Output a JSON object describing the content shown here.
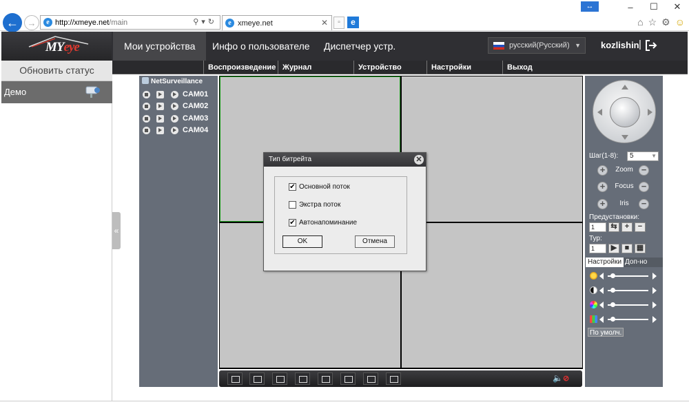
{
  "browser": {
    "url_host": "http://xmeye.net",
    "url_path": "/main",
    "tab_title": "xmeye.net"
  },
  "header": {
    "logo": "MYeye",
    "nav": {
      "devices": "Мои устройства",
      "user_info": "Инфо о пользователе",
      "device_manager": "Диспетчер устр."
    },
    "language": "русский(Русский)",
    "username": "kozlishin",
    "separator": "|"
  },
  "sidebar": {
    "refresh": "Обновить статус",
    "device": "Демо"
  },
  "menu": {
    "playback": "Воспроизведение",
    "log": "Журнал",
    "device": "Устройство",
    "settings": "Настройки",
    "exit": "Выход"
  },
  "tree": {
    "root": "NetSurveillance",
    "cameras": [
      "CAM01",
      "CAM02",
      "CAM03",
      "CAM04"
    ]
  },
  "ptz": {
    "step_label": "Шаг(1-8):",
    "step_value": "5",
    "zoom": "Zoom",
    "focus": "Focus",
    "iris": "Iris",
    "presets_label": "Предустановки:",
    "preset_value": "1",
    "tour_label": "Тур:",
    "tour_value": "1",
    "tab_settings": "Настройки",
    "tab_extra": "Доп-но",
    "defaults": "По умолч."
  },
  "dialog": {
    "title": "Тип битрейта",
    "main_stream": "Основной поток",
    "main_stream_checked": true,
    "extra_stream": "Экстра поток",
    "extra_stream_checked": false,
    "auto_remind": "Автонапоминание",
    "auto_remind_checked": true,
    "ok": "OK",
    "cancel": "Отмена"
  },
  "colors": {
    "header_bg": "#2f2f33",
    "panel_bg": "#666d78",
    "active_cell_border": "#1fa01f"
  }
}
